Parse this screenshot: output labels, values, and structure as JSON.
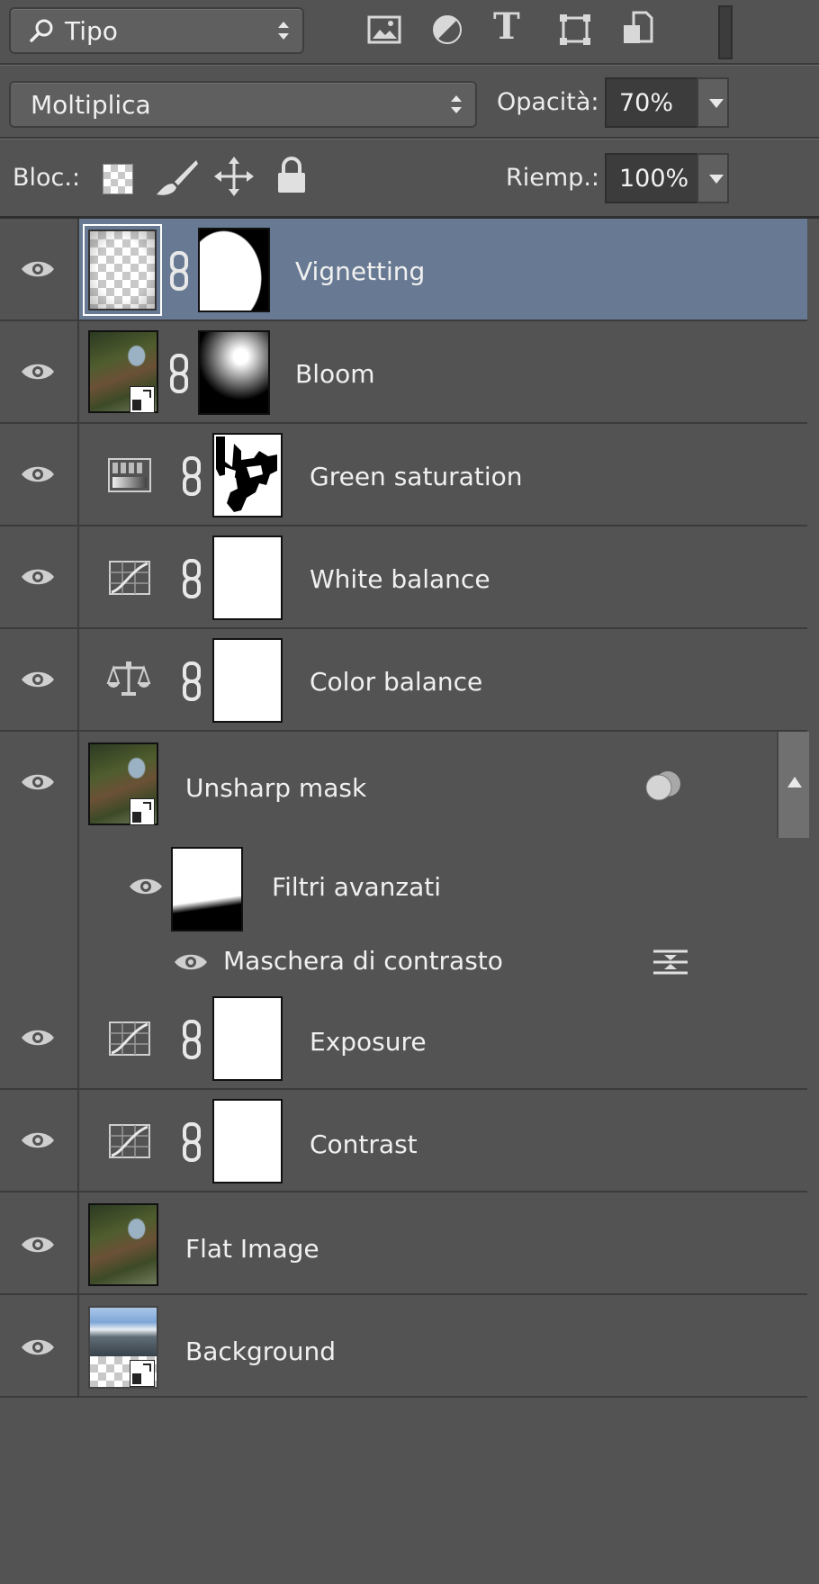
{
  "filter_bar": {
    "kind_label": "Tipo",
    "filter_icons": [
      "pixel-filter-icon",
      "adjustment-filter-icon",
      "type-filter-icon",
      "shape-filter-icon",
      "smart-object-filter-icon"
    ],
    "type_glyph": "T"
  },
  "blend_bar": {
    "blend_mode": "Moltiplica",
    "opacity_label": "Opacità:",
    "opacity_value": "70%"
  },
  "lock_bar": {
    "lock_label": "Bloc.:",
    "fill_label": "Riemp.:",
    "fill_value": "100%"
  },
  "layers": [
    {
      "name": "Vignetting",
      "selected": true,
      "type": "pixel-with-mask"
    },
    {
      "name": "Bloom",
      "type": "smart-object-with-mask"
    },
    {
      "name": "Green saturation",
      "type": "adjustment-gradient-map"
    },
    {
      "name": "White balance",
      "type": "adjustment-curves"
    },
    {
      "name": "Color balance",
      "type": "adjustment-color-balance"
    },
    {
      "name": "Unsharp mask",
      "type": "smart-object",
      "smart_filters_label": "Filtri avanzati",
      "filter_name": "Maschera di contrasto"
    },
    {
      "name": "Exposure",
      "type": "adjustment-curves"
    },
    {
      "name": "Contrast",
      "type": "adjustment-curves"
    },
    {
      "name": "Flat Image",
      "type": "pixel"
    },
    {
      "name": "Background",
      "type": "smart-object"
    }
  ],
  "colors": {
    "panel_bg": "#535353",
    "selected_row": "#687a93",
    "divider": "#3b3b3b"
  }
}
